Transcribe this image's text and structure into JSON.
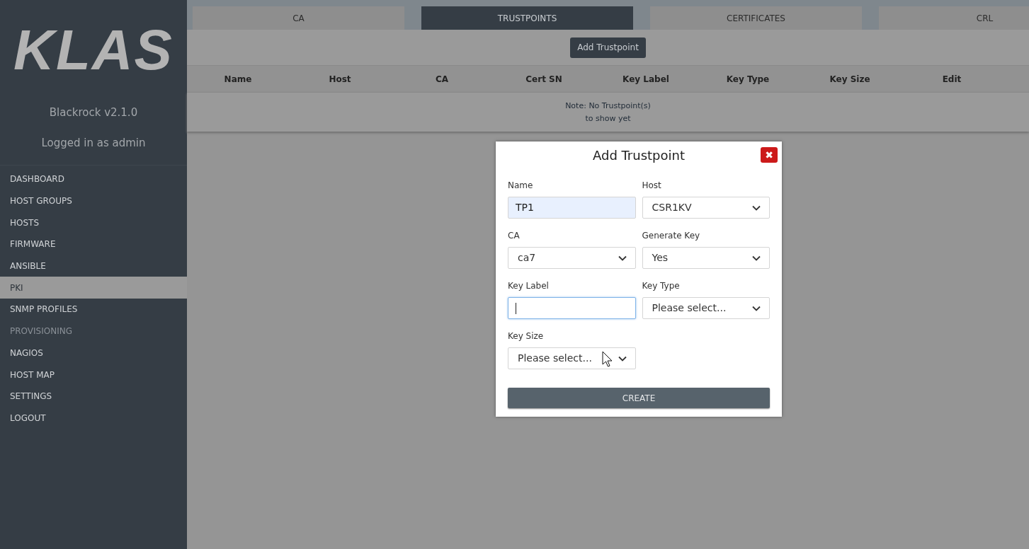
{
  "sidebar": {
    "logo": "KLAS",
    "version": "Blackrock v2.1.0",
    "user": "Logged in as admin",
    "items": [
      {
        "label": "DASHBOARD",
        "selected": false,
        "disabled": false
      },
      {
        "label": "HOST GROUPS",
        "selected": false,
        "disabled": false
      },
      {
        "label": "HOSTS",
        "selected": false,
        "disabled": false
      },
      {
        "label": "FIRMWARE",
        "selected": false,
        "disabled": false
      },
      {
        "label": "ANSIBLE",
        "selected": false,
        "disabled": false
      },
      {
        "label": "PKI",
        "selected": true,
        "disabled": false
      },
      {
        "label": "SNMP PROFILES",
        "selected": false,
        "disabled": false
      },
      {
        "label": "PROVISIONING",
        "selected": false,
        "disabled": true
      },
      {
        "label": "NAGIOS",
        "selected": false,
        "disabled": false
      },
      {
        "label": "HOST MAP",
        "selected": false,
        "disabled": false
      },
      {
        "label": "SETTINGS",
        "selected": false,
        "disabled": false
      },
      {
        "label": "LOGOUT",
        "selected": false,
        "disabled": false
      }
    ]
  },
  "tabs": [
    {
      "label": "CA",
      "selected": false
    },
    {
      "label": "TRUSTPOINTS",
      "selected": true
    },
    {
      "label": "CERTIFICATES",
      "selected": false
    },
    {
      "label": "CRL",
      "selected": false
    }
  ],
  "add_button": "Add Trustpoint",
  "table": {
    "columns": [
      "Name",
      "Host",
      "CA",
      "Cert SN",
      "Key Label",
      "Key Type",
      "Key Size",
      "Edit"
    ],
    "note": [
      "Note: No Trustpoint(s)",
      "to show yet"
    ]
  },
  "dialog": {
    "title": "Add Trustpoint",
    "close": "✖",
    "fields": [
      {
        "kind": "text",
        "label": "Name",
        "value": "TP1",
        "autofilled": true,
        "focused": false
      },
      {
        "kind": "select",
        "label": "Host",
        "value": "CSR1KV",
        "focused": false
      },
      {
        "kind": "select",
        "label": "CA",
        "value": "ca7",
        "focused": false
      },
      {
        "kind": "select",
        "label": "Generate Key",
        "value": "Yes",
        "focused": false
      },
      {
        "kind": "text",
        "label": "Key Label",
        "autofilled": false,
        "focused": true
      },
      {
        "kind": "select",
        "label": "Key Type",
        "value": "Please select...",
        "focused": false
      },
      {
        "kind": "select",
        "label": "Key Size",
        "value": "Please select...",
        "focused": false
      }
    ],
    "submit": "CREATE"
  }
}
